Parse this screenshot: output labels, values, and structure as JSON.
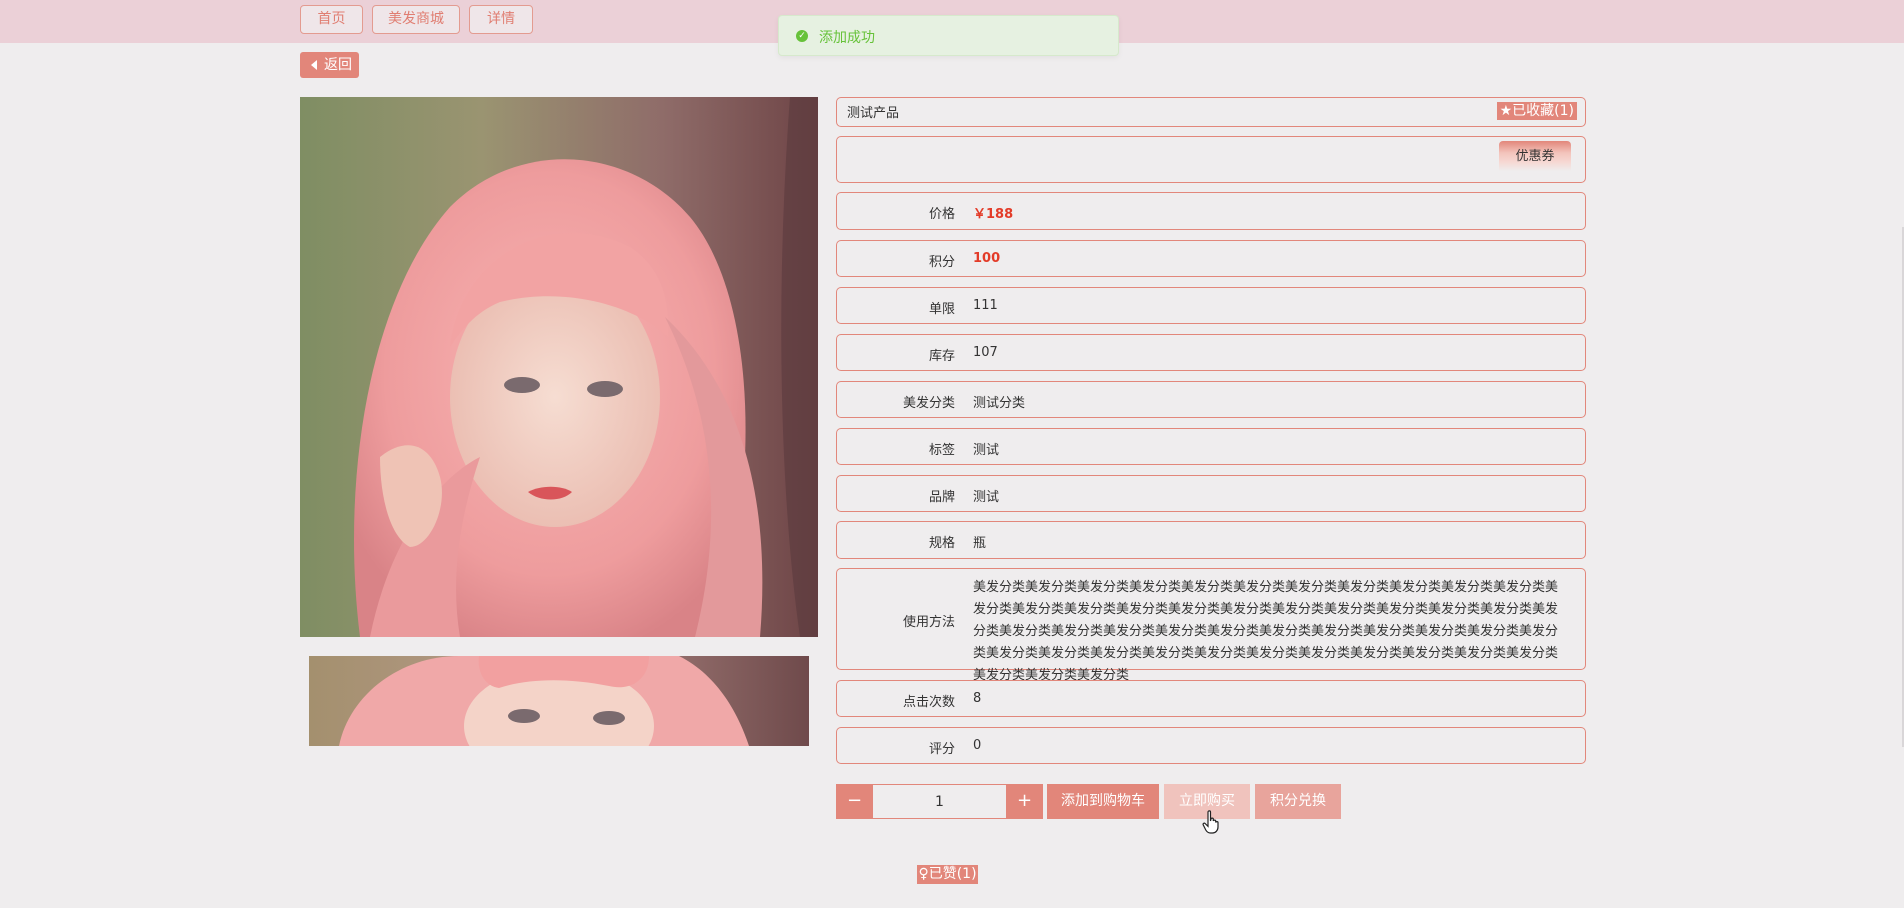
{
  "nav": {
    "home": "首页",
    "mall": "美发商城",
    "detail": "详情"
  },
  "toast": {
    "message": "添加成功"
  },
  "back_label": "返回",
  "product": {
    "name": "测试产品",
    "favorite_label": "已收藏(1)",
    "coupon_label": "优惠券",
    "fields": [
      {
        "label": "价格",
        "value": "￥188"
      },
      {
        "label": "积分",
        "value": "100"
      },
      {
        "label": "单限",
        "value": "111"
      },
      {
        "label": "库存",
        "value": "107"
      },
      {
        "label": "美发分类",
        "value": "测试分类"
      },
      {
        "label": "标签",
        "value": "测试"
      },
      {
        "label": "品牌",
        "value": "测试"
      },
      {
        "label": "规格",
        "value": "瓶"
      }
    ],
    "usage": {
      "label": "使用方法",
      "value": "美发分类美发分类美发分类美发分类美发分类美发分类美发分类美发分类美发分类美发分类美发分类美发分类美发分类美发分类美发分类美发分类美发分类美发分类美发分类美发分类美发分类美发分类美发分类美发分类美发分类美发分类美发分类美发分类美发分类美发分类美发分类美发分类美发分类美发分类美发分类美发分类美发分类美发分类美发分类美发分类美发分类美发分类美发分类美发分类美发分类美发分类美发分类美发分类"
    },
    "clicks": {
      "label": "点击次数",
      "value": "8"
    },
    "rating": {
      "label": "评分",
      "value": "0"
    }
  },
  "cart": {
    "minus": "−",
    "quantity": "1",
    "plus": "+",
    "add_to_cart": "添加到购物车",
    "buy_now": "立即购买",
    "redeem_points": "积分兑换"
  },
  "like_label": "已赞(1)",
  "colors": {
    "accent": "#e2867a",
    "topbar": "#ebd0d7",
    "price_red": "#e33b28",
    "toast_green": "#67c23a"
  }
}
